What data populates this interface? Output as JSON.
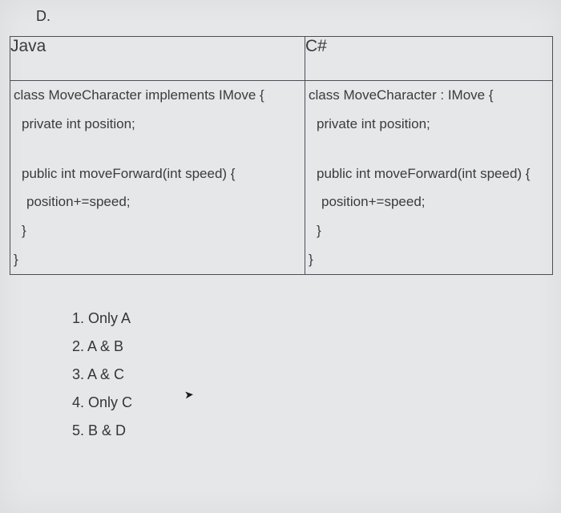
{
  "option_label": "D.",
  "table": {
    "headers": {
      "left": "Java",
      "right": "C#"
    },
    "left": {
      "l1": "class MoveCharacter implements IMove {",
      "l2": "private int position;",
      "l3": "public int moveForward(int speed) {",
      "l4": "position+=speed;",
      "l5": "}",
      "l6": "}"
    },
    "right": {
      "l1": "class MoveCharacter : IMove {",
      "l2": "private int position;",
      "l3": "public int moveForward(int speed) {",
      "l4": "position+=speed;",
      "l5": "}",
      "l6": "}"
    }
  },
  "answers": {
    "a1": "1. Only A",
    "a2": "2. A & B",
    "a3": "3. A & C",
    "a4": "4. Only C",
    "a5": "5. B & D"
  }
}
